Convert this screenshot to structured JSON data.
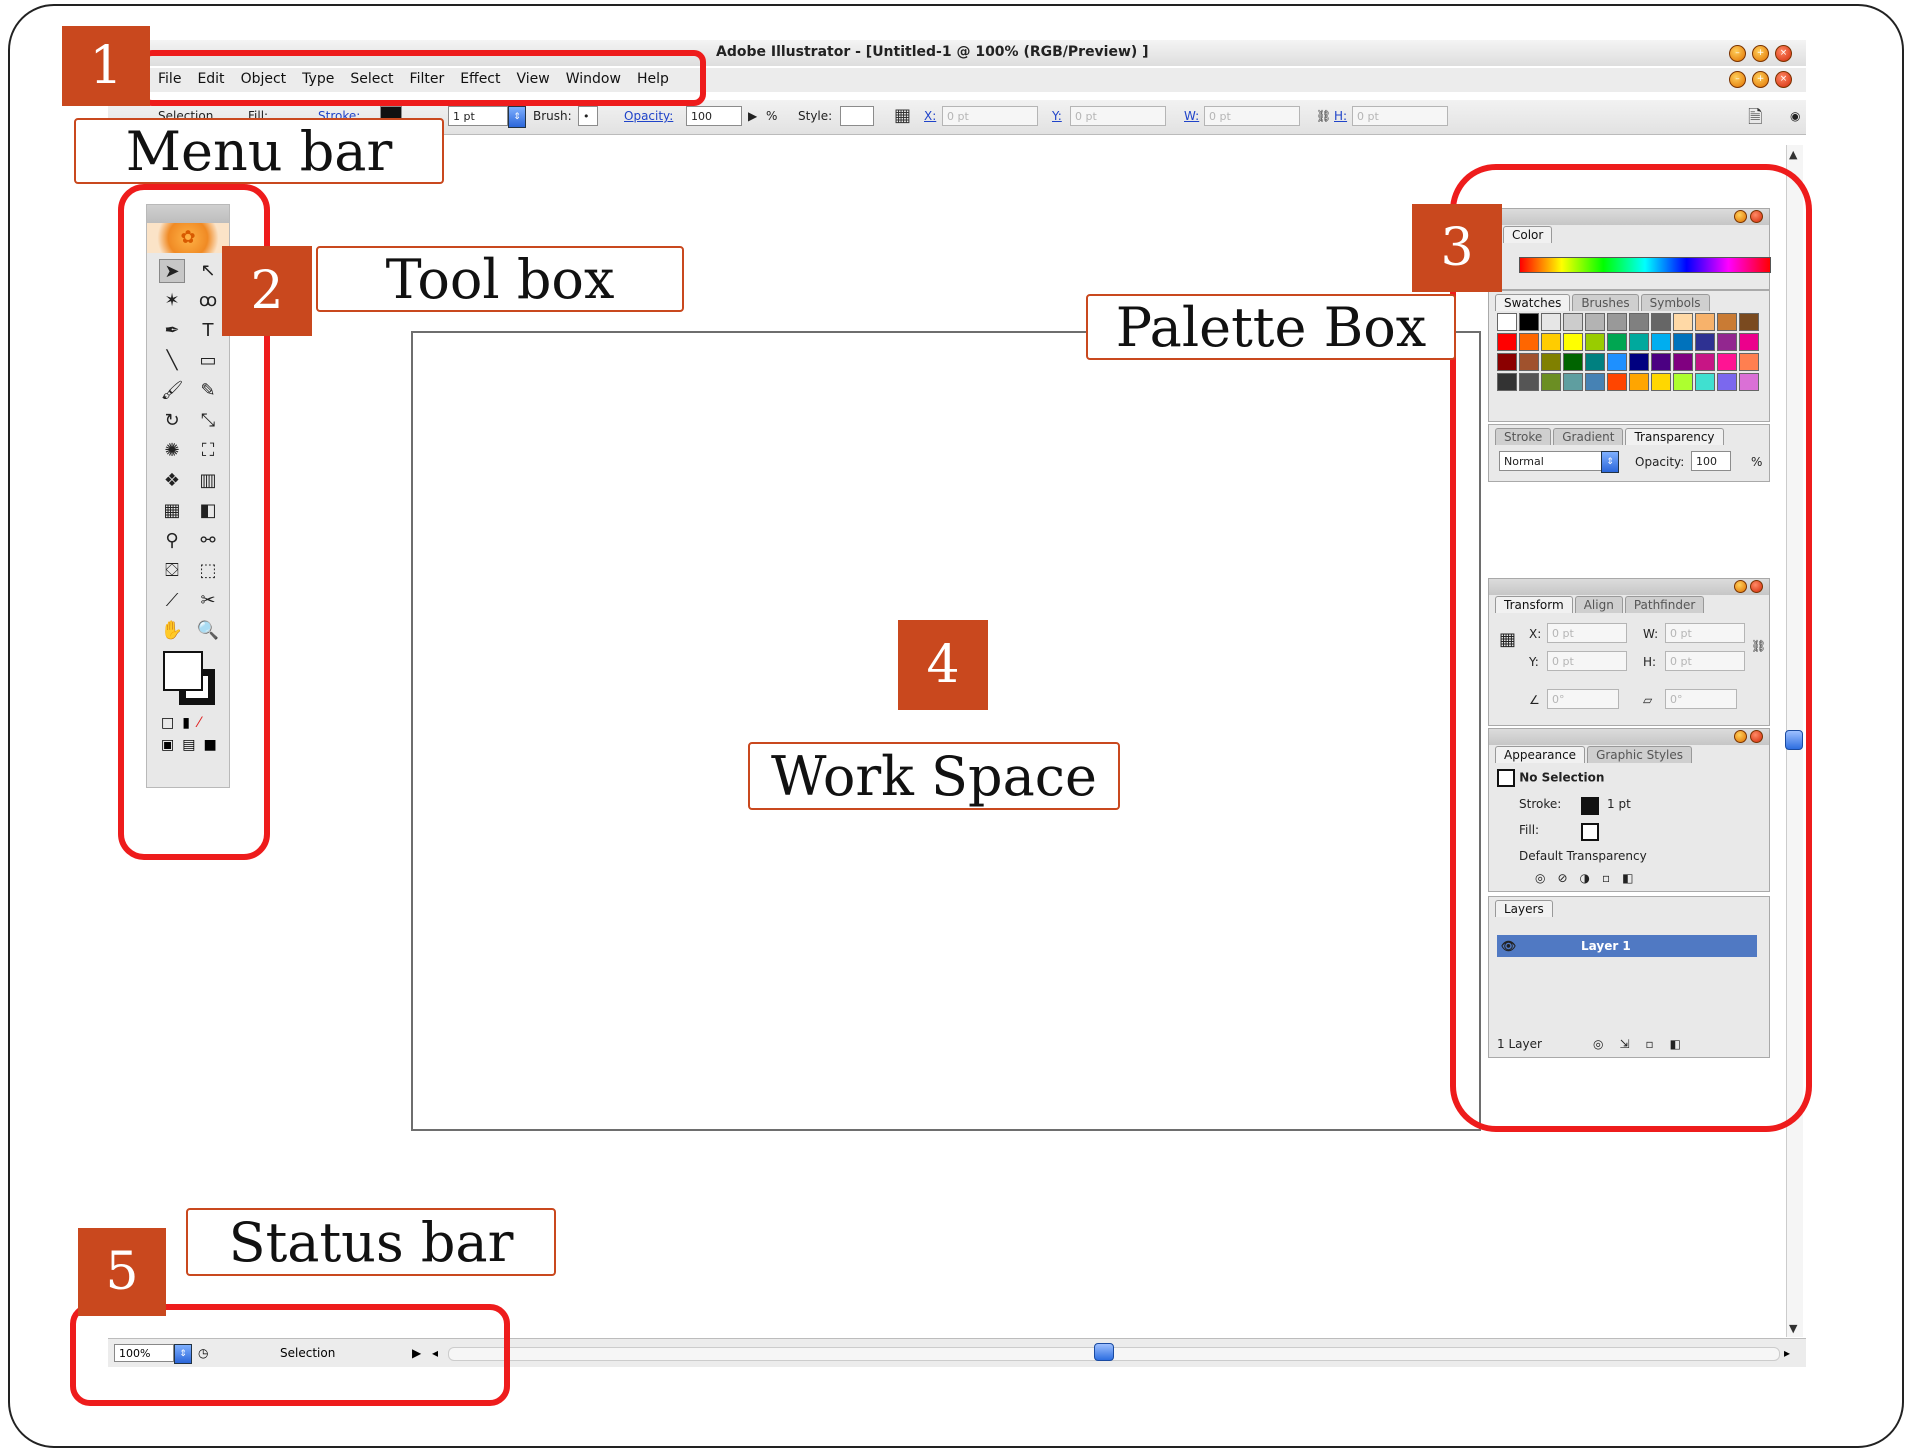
{
  "app": {
    "title": "Adobe Illustrator - [Untitled-1 @ 100% (RGB/Preview) ]",
    "menus": [
      "File",
      "Edit",
      "Object",
      "Type",
      "Select",
      "Filter",
      "Effect",
      "View",
      "Window",
      "Help"
    ]
  },
  "controlbar": {
    "selection_label": "Selection",
    "fill_label": "Fill:",
    "stroke_label": "Stroke:",
    "stroke_weight": "1 pt",
    "brush_label": "Brush:",
    "opacity_label": "Opacity:",
    "opacity_value": "100",
    "percent": "%",
    "style_label": "Style:",
    "x_label": "X:",
    "x_value": "0 pt",
    "y_label": "Y:",
    "y_value": "0 pt",
    "w_label": "W:",
    "w_value": "0 pt",
    "h_label": "H:",
    "h_value": "0 pt"
  },
  "palettes": {
    "color_title": "Color",
    "swatch_tabs": [
      "Swatches",
      "Brushes",
      "Symbols"
    ],
    "transparency_tabs": [
      "Stroke",
      "Gradient",
      "Transparency"
    ],
    "blend_mode": "Normal",
    "opacity_label": "Opacity:",
    "opacity_value": "100",
    "percent": "%",
    "transform_tabs": [
      "Transform",
      "Align",
      "Pathfinder"
    ],
    "x_label": "X:",
    "x_value": "0 pt",
    "y_label": "Y:",
    "y_value": "0 pt",
    "w_label": "W:",
    "w_value": "0 pt",
    "h_label": "H:",
    "h_value": "0 pt",
    "angle_value": "0°",
    "shear_value": "0°",
    "appearance_tabs": [
      "Appearance",
      "Graphic Styles"
    ],
    "no_selection": "No Selection",
    "stroke_label": "Stroke:",
    "stroke_value": "1 pt",
    "fill_label": "Fill:",
    "default_transparency": "Default Transparency",
    "layers_title": "Layers",
    "layer_name": "Layer 1",
    "layer_count": "1 Layer"
  },
  "statusbar": {
    "zoom": "100%",
    "tool": "Selection"
  },
  "annotations": {
    "n1": "1",
    "label1": "Menu bar",
    "n2": "2",
    "label2": "Tool box",
    "n3": "3",
    "label3": "Palette Box",
    "n4": "4",
    "label4": "Work Space",
    "n5": "5",
    "label5": "Status bar"
  },
  "colors": {
    "annotation_red": "#ee1c1c",
    "annotation_badge": "#c9481e",
    "layer_highlight": "#5079c3"
  }
}
